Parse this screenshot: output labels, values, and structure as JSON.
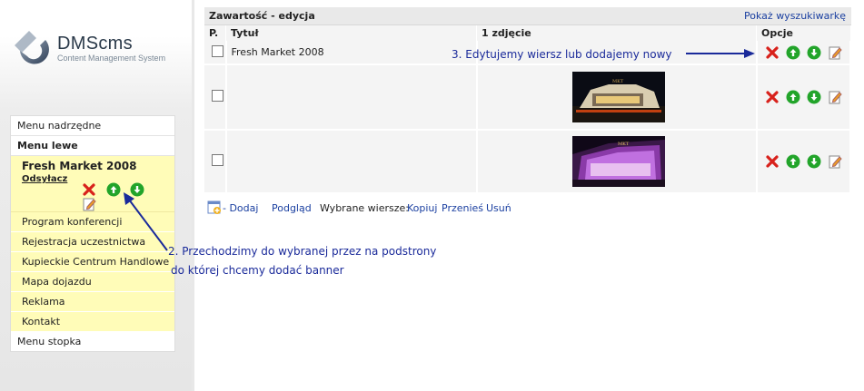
{
  "logo": {
    "name": "DMScms",
    "tagline": "Content Management System"
  },
  "sidebar": {
    "top": "Menu nadrzędne",
    "left_header": "Menu lewe",
    "active": {
      "title": "Fresh Market 2008",
      "link": "Odsyłacz"
    },
    "items": [
      {
        "label": "Program konferencji"
      },
      {
        "label": "Rejestracja uczestnictwa"
      },
      {
        "label": "Kupieckie Centrum Handlowe"
      },
      {
        "label": "Mapa dojazdu"
      },
      {
        "label": "Reklama"
      },
      {
        "label": "Kontakt"
      }
    ],
    "bottom": "Menu stopka"
  },
  "main": {
    "title": "Zawartość - edycja",
    "search_link": "Pokaż wyszukiwarkę",
    "columns": {
      "p": "P.",
      "title": "Tytuł",
      "photo": "1 zdjęcie",
      "options": "Opcje"
    },
    "rows": [
      {
        "title": "Fresh Market 2008",
        "has_image": false
      },
      {
        "title": "",
        "has_image": true
      },
      {
        "title": "",
        "has_image": true
      }
    ],
    "footer": {
      "add": "- Dodaj",
      "preview": "Podgląd",
      "selected": "Wybrane wiersze:",
      "copy": "Kopiuj",
      "move": "Przenieś",
      "delete": "Usuń"
    }
  },
  "annotations": {
    "step3": "3. Edytujemy wiersz lub dodajemy nowy",
    "step2_line1": "2. Przechodzimy do wybranej przez na podstrony",
    "step2_line2": "do której chcemy dodać banner"
  },
  "colors": {
    "menu_highlight": "#fffcb8",
    "link": "#1a3fa0",
    "annotation": "#1a2a9a"
  }
}
